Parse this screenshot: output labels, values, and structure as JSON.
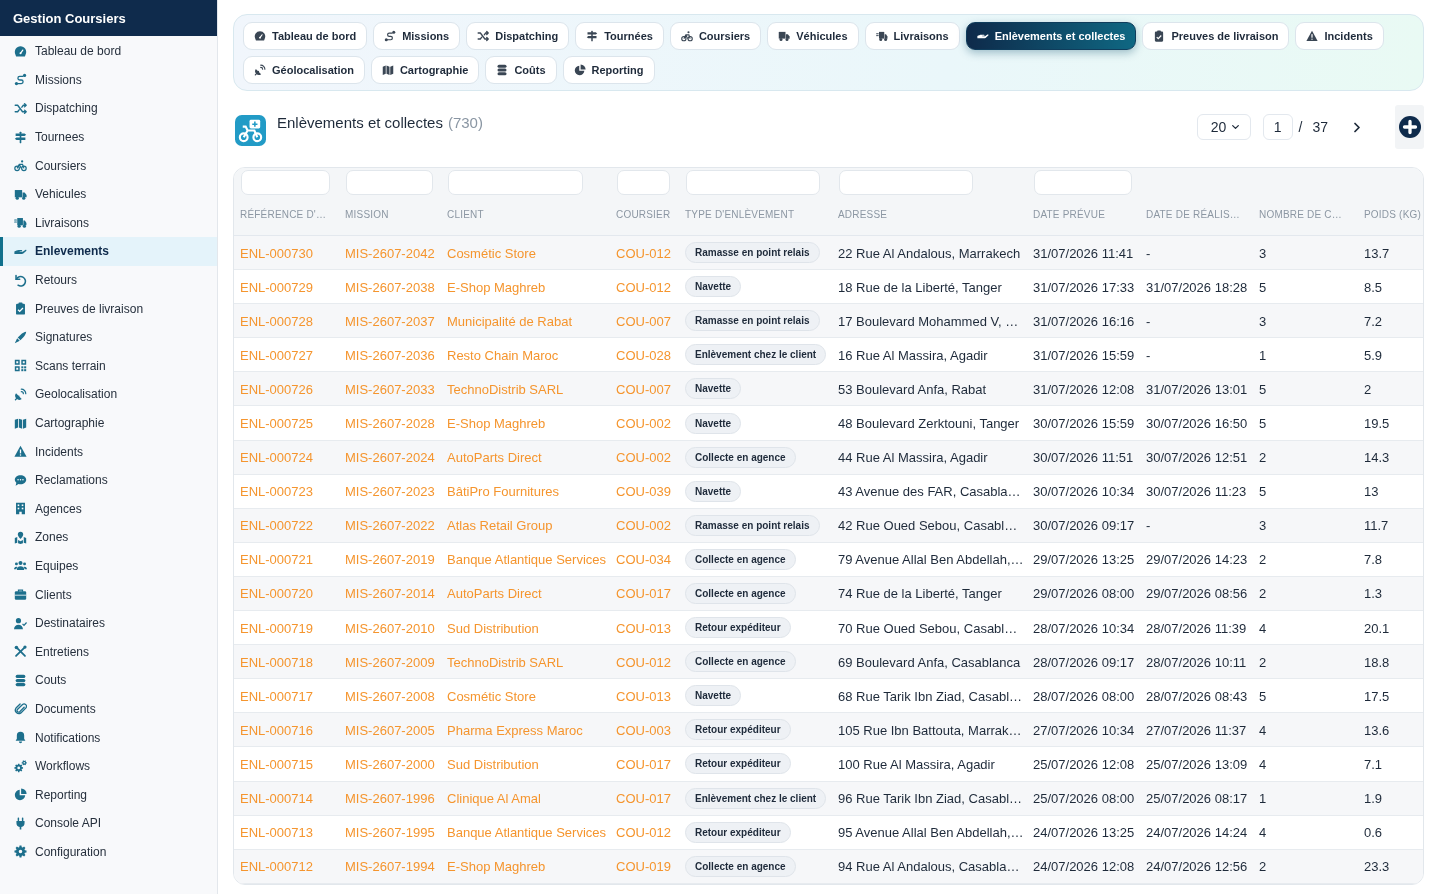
{
  "sidebar": {
    "title": "Gestion Coursiers",
    "items": [
      {
        "label": "Tableau de bord",
        "selected": false
      },
      {
        "label": "Missions",
        "selected": false
      },
      {
        "label": "Dispatching",
        "selected": false
      },
      {
        "label": "Tournees",
        "selected": false
      },
      {
        "label": "Coursiers",
        "selected": false
      },
      {
        "label": "Vehicules",
        "selected": false
      },
      {
        "label": "Livraisons",
        "selected": false
      },
      {
        "label": "Enlevements",
        "selected": true
      },
      {
        "label": "Retours",
        "selected": false
      },
      {
        "label": "Preuves de livraison",
        "selected": false
      },
      {
        "label": "Signatures",
        "selected": false
      },
      {
        "label": "Scans terrain",
        "selected": false
      },
      {
        "label": "Geolocalisation",
        "selected": false
      },
      {
        "label": "Cartographie",
        "selected": false
      },
      {
        "label": "Incidents",
        "selected": false
      },
      {
        "label": "Reclamations",
        "selected": false
      },
      {
        "label": "Agences",
        "selected": false
      },
      {
        "label": "Zones",
        "selected": false
      },
      {
        "label": "Equipes",
        "selected": false
      },
      {
        "label": "Clients",
        "selected": false
      },
      {
        "label": "Destinataires",
        "selected": false
      },
      {
        "label": "Entretiens",
        "selected": false
      },
      {
        "label": "Couts",
        "selected": false
      },
      {
        "label": "Documents",
        "selected": false
      },
      {
        "label": "Notifications",
        "selected": false
      },
      {
        "label": "Workflows",
        "selected": false
      },
      {
        "label": "Reporting",
        "selected": false
      },
      {
        "label": "Console API",
        "selected": false
      },
      {
        "label": "Configuration",
        "selected": false
      }
    ]
  },
  "tabs": [
    {
      "label": "Tableau de bord",
      "selected": false
    },
    {
      "label": "Missions",
      "selected": false
    },
    {
      "label": "Dispatching",
      "selected": false
    },
    {
      "label": "Tournées",
      "selected": false
    },
    {
      "label": "Coursiers",
      "selected": false
    },
    {
      "label": "Véhicules",
      "selected": false
    },
    {
      "label": "Livraisons",
      "selected": false
    },
    {
      "label": "Enlèvements et collectes",
      "selected": true
    },
    {
      "label": "Preuves de livraison",
      "selected": false
    },
    {
      "label": "Incidents",
      "selected": false
    },
    {
      "label": "Géolocalisation",
      "selected": false
    },
    {
      "label": "Cartographie",
      "selected": false
    },
    {
      "label": "Coûts",
      "selected": false
    },
    {
      "label": "Reporting",
      "selected": false
    }
  ],
  "page_header": {
    "title": "Enlèvements et collectes",
    "count": "(730)",
    "page_size": "20",
    "page": "1",
    "page_separator": "/",
    "page_total": "37"
  },
  "table": {
    "columns": [
      {
        "label": "RÉFÉRENCE D'…",
        "kind": "link",
        "filterable": true
      },
      {
        "label": "MISSION",
        "kind": "link",
        "filterable": true
      },
      {
        "label": "CLIENT",
        "kind": "link",
        "filterable": true
      },
      {
        "label": "COURSIER",
        "kind": "link",
        "filterable": true
      },
      {
        "label": "TYPE D'ENLÈVEMENT",
        "kind": "badge",
        "filterable": true
      },
      {
        "label": "ADRESSE",
        "kind": "text",
        "filterable": true
      },
      {
        "label": "DATE PRÉVUE",
        "kind": "text",
        "filterable": true
      },
      {
        "label": "DATE DE RÉALIS…",
        "kind": "text",
        "filterable": false
      },
      {
        "label": "NOMBRE DE C…",
        "kind": "text",
        "filterable": false
      },
      {
        "label": "POIDS (KG)",
        "kind": "text",
        "filterable": false
      }
    ],
    "rows": [
      [
        "ENL-000730",
        "MIS-2607-2042",
        "Cosmétic Store",
        "COU-012",
        "Ramasse en point relais",
        "22 Rue Al Andalous, Marrakech",
        "31/07/2026 11:41",
        "-",
        "3",
        "13.7"
      ],
      [
        "ENL-000729",
        "MIS-2607-2038",
        "E-Shop Maghreb",
        "COU-012",
        "Navette",
        "18 Rue de la Liberté, Tanger",
        "31/07/2026 17:33",
        "31/07/2026 18:28",
        "5",
        "8.5"
      ],
      [
        "ENL-000728",
        "MIS-2607-2037",
        "Municipalité de Rabat",
        "COU-007",
        "Ramasse en point relais",
        "17 Boulevard Mohammed V, …",
        "31/07/2026 16:16",
        "-",
        "3",
        "7.2"
      ],
      [
        "ENL-000727",
        "MIS-2607-2036",
        "Resto Chain Maroc",
        "COU-028",
        "Enlèvement chez le client",
        "16 Rue Al Massira, Agadir",
        "31/07/2026 15:59",
        "-",
        "1",
        "5.9"
      ],
      [
        "ENL-000726",
        "MIS-2607-2033",
        "TechnoDistrib SARL",
        "COU-007",
        "Navette",
        "53 Boulevard Anfa, Rabat",
        "31/07/2026 12:08",
        "31/07/2026 13:01",
        "5",
        "2"
      ],
      [
        "ENL-000725",
        "MIS-2607-2028",
        "E-Shop Maghreb",
        "COU-002",
        "Navette",
        "48 Boulevard Zerktouni, Tanger",
        "30/07/2026 15:59",
        "30/07/2026 16:50",
        "5",
        "19.5"
      ],
      [
        "ENL-000724",
        "MIS-2607-2024",
        "AutoParts Direct",
        "COU-002",
        "Collecte en agence",
        "44 Rue Al Massira, Agadir",
        "30/07/2026 11:51",
        "30/07/2026 12:51",
        "2",
        "14.3"
      ],
      [
        "ENL-000723",
        "MIS-2607-2023",
        "BâtiPro Fournitures",
        "COU-039",
        "Navette",
        "43 Avenue des FAR, Casabla…",
        "30/07/2026 10:34",
        "30/07/2026 11:23",
        "5",
        "13"
      ],
      [
        "ENL-000722",
        "MIS-2607-2022",
        "Atlas Retail Group",
        "COU-002",
        "Ramasse en point relais",
        "42 Rue Oued Sebou, Casabl…",
        "30/07/2026 09:17",
        "-",
        "3",
        "11.7"
      ],
      [
        "ENL-000721",
        "MIS-2607-2019",
        "Banque Atlantique Services",
        "COU-034",
        "Collecte en agence",
        "79 Avenue Allal Ben Abdellah,…",
        "29/07/2026 13:25",
        "29/07/2026 14:23",
        "2",
        "7.8"
      ],
      [
        "ENL-000720",
        "MIS-2607-2014",
        "AutoParts Direct",
        "COU-017",
        "Collecte en agence",
        "74 Rue de la Liberté, Tanger",
        "29/07/2026 08:00",
        "29/07/2026 08:56",
        "2",
        "1.3"
      ],
      [
        "ENL-000719",
        "MIS-2607-2010",
        "Sud Distribution",
        "COU-013",
        "Retour expéditeur",
        "70 Rue Oued Sebou, Casabl…",
        "28/07/2026 10:34",
        "28/07/2026 11:39",
        "4",
        "20.1"
      ],
      [
        "ENL-000718",
        "MIS-2607-2009",
        "TechnoDistrib SARL",
        "COU-012",
        "Collecte en agence",
        "69 Boulevard Anfa, Casablanca",
        "28/07/2026 09:17",
        "28/07/2026 10:11",
        "2",
        "18.8"
      ],
      [
        "ENL-000717",
        "MIS-2607-2008",
        "Cosmétic Store",
        "COU-013",
        "Navette",
        "68 Rue Tarik Ibn Ziad, Casabl…",
        "28/07/2026 08:00",
        "28/07/2026 08:43",
        "5",
        "17.5"
      ],
      [
        "ENL-000716",
        "MIS-2607-2005",
        "Pharma Express Maroc",
        "COU-003",
        "Retour expéditeur",
        "105 Rue Ibn Battouta, Marrak…",
        "27/07/2026 10:34",
        "27/07/2026 11:37",
        "4",
        "13.6"
      ],
      [
        "ENL-000715",
        "MIS-2607-2000",
        "Sud Distribution",
        "COU-017",
        "Retour expéditeur",
        "100 Rue Al Massira, Agadir",
        "25/07/2026 12:08",
        "25/07/2026 13:09",
        "4",
        "7.1"
      ],
      [
        "ENL-000714",
        "MIS-2607-1996",
        "Clinique Al Amal",
        "COU-017",
        "Enlèvement chez le client",
        "96 Rue Tarik Ibn Ziad, Casabl…",
        "25/07/2026 08:00",
        "25/07/2026 08:17",
        "1",
        "1.9"
      ],
      [
        "ENL-000713",
        "MIS-2607-1995",
        "Banque Atlantique Services",
        "COU-012",
        "Retour expéditeur",
        "95 Avenue Allal Ben Abdellah,…",
        "24/07/2026 13:25",
        "24/07/2026 14:24",
        "4",
        "0.6"
      ],
      [
        "ENL-000712",
        "MIS-2607-1994",
        "E-Shop Maghreb",
        "COU-019",
        "Collecte en agence",
        "94 Rue Al Andalous, Casabla…",
        "24/07/2026 12:08",
        "24/07/2026 12:56",
        "2",
        "23.3"
      ]
    ]
  }
}
